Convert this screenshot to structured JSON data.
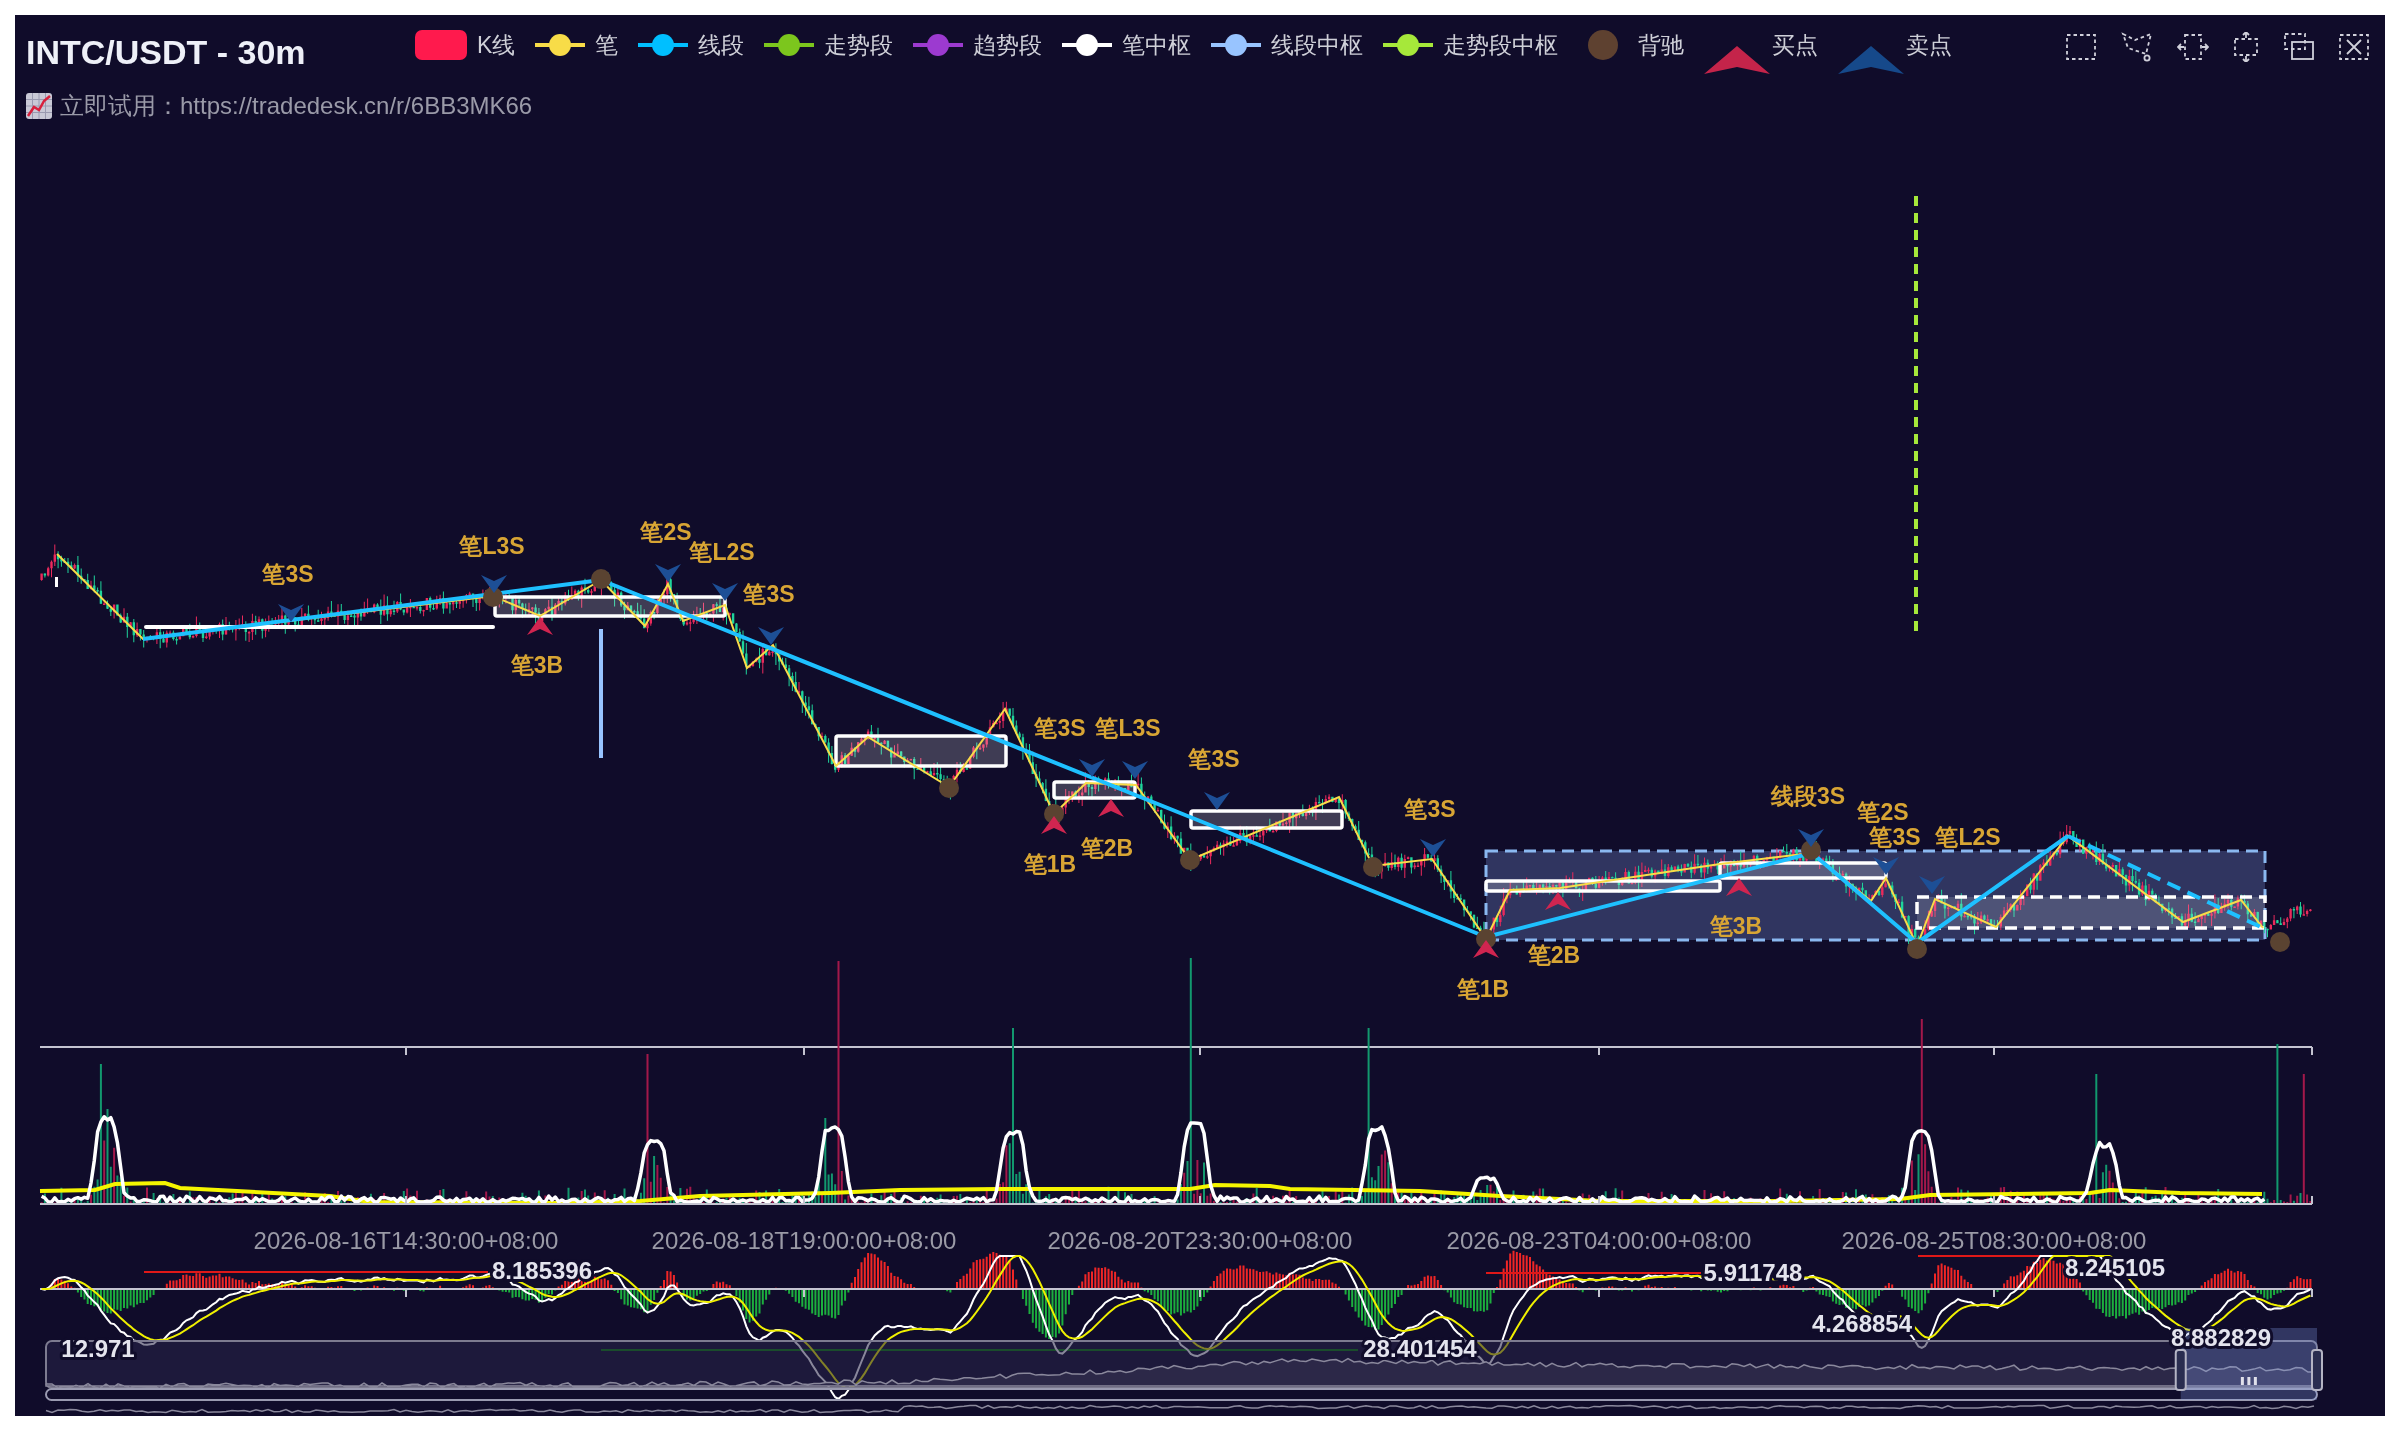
{
  "title": {
    "text": "INTC/USDT - 30m",
    "subtext": "立即试用：https://tradedesk.cn/r/6BB3MK66"
  },
  "legend": [
    {
      "label": "K线",
      "kind": "box",
      "color": "#ff1a4d"
    },
    {
      "label": "笔",
      "kind": "line",
      "color": "#f8dc48"
    },
    {
      "label": "线段",
      "kind": "line",
      "color": "#00bfff"
    },
    {
      "label": "走势段",
      "kind": "line",
      "color": "#7cc61d"
    },
    {
      "label": "趋势段",
      "kind": "line",
      "color": "#9c3ad0"
    },
    {
      "label": "笔中枢",
      "kind": "line",
      "color": "#ffffff"
    },
    {
      "label": "线段中枢",
      "kind": "line",
      "color": "#98c4ff"
    },
    {
      "label": "走势段中枢",
      "kind": "line",
      "color": "#a6e83a"
    },
    {
      "label": "背驰",
      "kind": "dot",
      "color": "#5e4130"
    },
    {
      "label": "买点",
      "kind": "chevron",
      "color": "#c4244a"
    },
    {
      "label": "卖点",
      "kind": "chevron",
      "color": "#16498a"
    }
  ],
  "chart": {
    "signal_labels": [
      "笔3S",
      "笔L3S",
      "笔3B",
      "笔2S",
      "笔L2S",
      "笔3S",
      "笔3S",
      "笔L3S",
      "笔1B",
      "笔2B",
      "笔3S",
      "笔3S",
      "线段3S",
      "笔2S",
      "笔3S",
      "笔L2S",
      "笔2B",
      "笔3B",
      "笔1B"
    ],
    "x_axis_labels": [
      "2026-08-16T14:30:00+08:00",
      "2026-08-18T19:00:00+08:00",
      "2026-08-20T23:30:00+08:00",
      "2026-08-23T04:00:00+08:00",
      "2026-08-25T08:30:00+08:00"
    ],
    "value_labels": [
      "12.971",
      "8.185396",
      "28.401454",
      "5.911748",
      "4.268854",
      "8.245105",
      "8.882829"
    ],
    "zoom_slider": {
      "level": 0.06
    }
  }
}
